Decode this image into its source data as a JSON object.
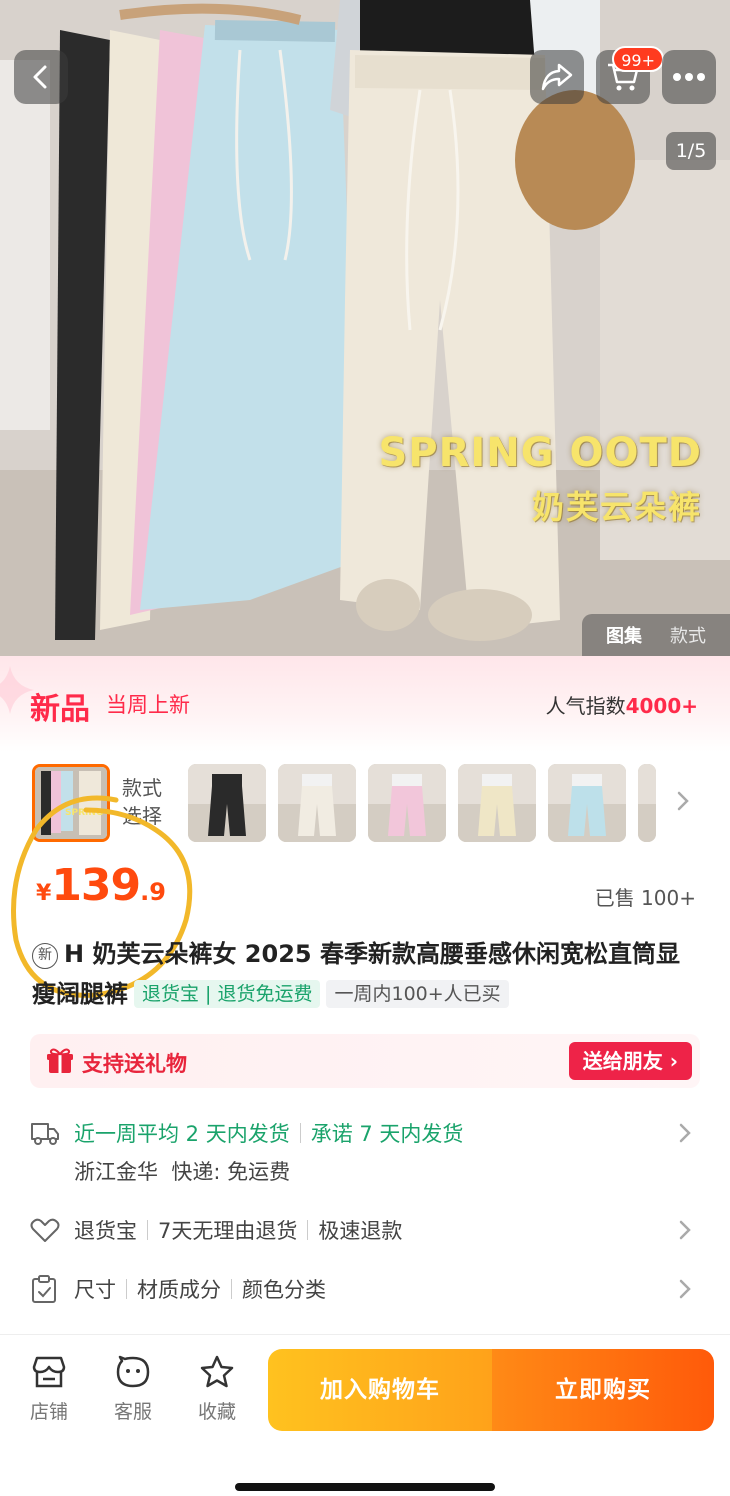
{
  "header": {
    "cart_badge": "99+",
    "page_indicator": "1/5"
  },
  "hero": {
    "overlay_line1": "SPRING OOTD",
    "overlay_line2": "奶芙云朵裤",
    "gallery_tabs": [
      "图集",
      "款式"
    ]
  },
  "banner": {
    "tag": "新品",
    "subtitle": "当周上新",
    "popularity_label": "人气指数",
    "popularity_value": "4000+"
  },
  "styles": {
    "label": "款式\n选择",
    "thumb_overlay_text": "SPRING OOTD",
    "thumbnails": [
      {
        "color": "#2a2a2a"
      },
      {
        "color": "#f1ece2"
      },
      {
        "color": "#f2c6da"
      },
      {
        "color": "#efe6c6"
      },
      {
        "color": "#bde0ea"
      },
      {
        "color": "#e9e2d8"
      }
    ]
  },
  "price": {
    "currency": "¥",
    "integer": "139",
    "decimal": ".9",
    "sold": "已售 100+"
  },
  "product": {
    "new_badge": "新",
    "title": "H 奶芙云朵裤女 2025 春季新款高腰垂感休闲宽松直筒显瘦阔腿裤",
    "tag_green": "退货宝 | 退货免运费",
    "tag_gray": "一周内100+人已买"
  },
  "gift": {
    "label": "支持送礼物",
    "button": "送给朋友"
  },
  "shipping": {
    "part1": "近一周平均 2 天内发货",
    "part2": "承诺 7 天内发货",
    "line2": "浙江金华  快递: 免运费"
  },
  "returns": {
    "items": [
      "退货宝",
      "7天无理由退货",
      "极速退款"
    ]
  },
  "specs": {
    "items": [
      "尺寸",
      "材质成分",
      "颜色分类"
    ]
  },
  "bottom": {
    "store": "店铺",
    "service": "客服",
    "favorite": "收藏",
    "add_to_cart": "加入购物车",
    "buy_now": "立即购买"
  },
  "colors": {
    "accent_red": "#ff2a4a",
    "price_orange": "#ff4a0e",
    "green": "#1aa36b",
    "annotation_yellow": "#f2b82a"
  }
}
